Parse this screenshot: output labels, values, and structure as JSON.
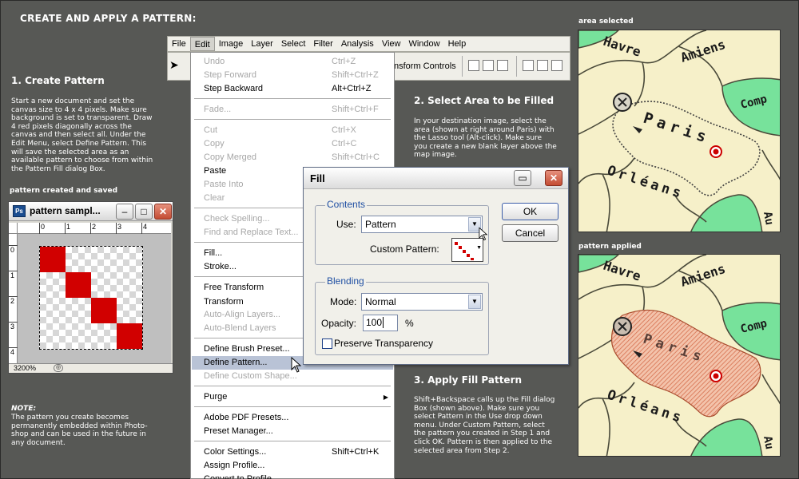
{
  "page": {
    "title": "CREATE AND APPLY A PATTERN:"
  },
  "step1": {
    "heading": "1. Create Pattern",
    "lines": [
      "Start a new document and set the",
      "canvas size to 4 x 4 pixels. Make sure",
      "background is set to transparent. Draw",
      "4 red pixels diagonally across the",
      "canvas and then select all. Under the",
      "Edit Menu, select Define Pattern. This",
      "will save the selected area as an",
      "available pattern to choose from within",
      "the Pattern Fill dialog Box."
    ],
    "caption": "pattern created and saved"
  },
  "pattern_window": {
    "title": "pattern sampl...",
    "zoom": "3200%",
    "ruler_top": [
      "0",
      "1",
      "2",
      "3",
      "4"
    ],
    "ruler_left": [
      "0",
      "1",
      "2",
      "3",
      "4"
    ],
    "ps_icon": "Ps"
  },
  "note": {
    "label": "NOTE:",
    "lines": [
      "The pattern you create becomes",
      "permanently embedded within Photo-",
      "shop and can be used in the future in",
      "any document."
    ]
  },
  "menubar": {
    "items": [
      "File",
      "Edit",
      "Image",
      "Layer",
      "Select",
      "Filter",
      "Analysis",
      "View",
      "Window",
      "Help"
    ],
    "active": "Edit"
  },
  "toolbar": {
    "transform_controls": "nsform Controls"
  },
  "edit_menu": {
    "items": [
      {
        "label": "Undo",
        "shortcut": "Ctrl+Z",
        "disabled": true
      },
      {
        "label": "Step Forward",
        "shortcut": "Shift+Ctrl+Z",
        "disabled": true
      },
      {
        "label": "Step Backward",
        "shortcut": "Alt+Ctrl+Z",
        "disabled": false
      },
      {
        "label": "Fade...",
        "shortcut": "Shift+Ctrl+F",
        "disabled": true
      },
      {
        "label": "Cut",
        "shortcut": "Ctrl+X",
        "disabled": true
      },
      {
        "label": "Copy",
        "shortcut": "Ctrl+C",
        "disabled": true
      },
      {
        "label": "Copy Merged",
        "shortcut": "Shift+Ctrl+C",
        "disabled": true
      },
      {
        "label": "Paste",
        "shortcut": "",
        "disabled": false
      },
      {
        "label": "Paste Into",
        "shortcut": "",
        "disabled": true
      },
      {
        "label": "Clear",
        "shortcut": "",
        "disabled": true
      },
      {
        "label": "Check Spelling...",
        "shortcut": "",
        "disabled": true
      },
      {
        "label": "Find and Replace Text...",
        "shortcut": "",
        "disabled": true
      },
      {
        "label": "Fill...",
        "shortcut": "",
        "disabled": false
      },
      {
        "label": "Stroke...",
        "shortcut": "",
        "disabled": false
      },
      {
        "label": "Free Transform",
        "shortcut": "",
        "disabled": false
      },
      {
        "label": "Transform",
        "shortcut": "",
        "disabled": false
      },
      {
        "label": "Auto-Align Layers...",
        "shortcut": "",
        "disabled": true
      },
      {
        "label": "Auto-Blend Layers",
        "shortcut": "",
        "disabled": true
      },
      {
        "label": "Define Brush Preset...",
        "shortcut": "",
        "disabled": false
      },
      {
        "label": "Define Pattern...",
        "shortcut": "",
        "disabled": false,
        "highlighted": true
      },
      {
        "label": "Define Custom Shape...",
        "shortcut": "",
        "disabled": true
      },
      {
        "label": "Purge",
        "shortcut": "",
        "disabled": false,
        "submenu": true
      },
      {
        "label": "Adobe PDF Presets...",
        "shortcut": "",
        "disabled": false
      },
      {
        "label": "Preset Manager...",
        "shortcut": "",
        "disabled": false
      },
      {
        "label": "Color Settings...",
        "shortcut": "Shift+Ctrl+K",
        "disabled": false
      },
      {
        "label": "Assign Profile...",
        "shortcut": "",
        "disabled": false
      },
      {
        "label": "Convert to Profile...",
        "shortcut": "",
        "disabled": false
      }
    ]
  },
  "fill_dialog": {
    "title": "Fill",
    "contents_label": "Contents",
    "use_label": "Use:",
    "use_value": "Pattern",
    "custom_pattern_label": "Custom Pattern:",
    "blending_label": "Blending",
    "mode_label": "Mode:",
    "mode_value": "Normal",
    "opacity_label": "Opacity:",
    "opacity_value": "100",
    "opacity_unit": "%",
    "preserve_label": "Preserve Transparency",
    "ok_label": "OK",
    "cancel_label": "Cancel"
  },
  "step2": {
    "heading": "2. Select Area to be Filled",
    "lines": [
      "In your destination image, select the",
      "area (shown at right around Paris) with",
      "the Lasso tool (Alt-click). Make sure",
      "you create a new blank layer above the",
      "map image."
    ]
  },
  "step3": {
    "heading": "3. Apply Fill Pattern",
    "lines": [
      "Shift+Backspace calls up the Fill dialog",
      "Box (shown above). Make sure you",
      "select Pattern in the Use drop down",
      "menu. Under Custom Pattern, select",
      "the pattern you created in Step 1 and",
      "click OK. Pattern is then applied to the",
      "selected area from Step 2."
    ]
  },
  "maps": {
    "selected_caption": "area selected",
    "applied_caption": "pattern applied",
    "labels": {
      "havre": "Havre",
      "amiens": "Amiens",
      "paris": "Paris",
      "orleans": "Orléans",
      "comp": "Comp",
      "au": "Au"
    }
  },
  "colors": {
    "background": "#575855",
    "pattern_red": "#d10000",
    "map_paper": "#f6f0c9",
    "map_green": "#77e29b",
    "highlight": "#b9c3d6"
  }
}
